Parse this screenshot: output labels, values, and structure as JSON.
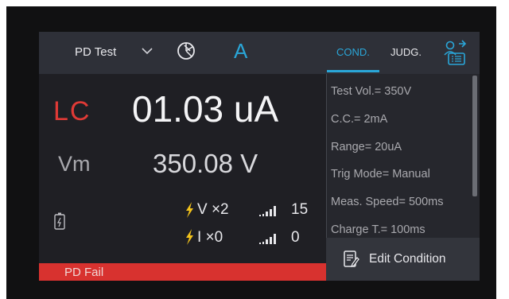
{
  "header": {
    "mode_label": "PD Test",
    "ameter_symbol": "A",
    "tabs": [
      {
        "label": "COND.",
        "active": true
      },
      {
        "label": "JUDG.",
        "active": false
      }
    ],
    "icons": [
      "chevron-down-icon",
      "pie-chart-icon",
      "user-list-icon"
    ]
  },
  "measurement": {
    "lc_label": "LC",
    "lc_value": "01.03 uA",
    "vm_label": "Vm",
    "vm_value": "350.08 V"
  },
  "counters": {
    "voltage": "V ×2",
    "current": "I ×0",
    "signal_1": "15",
    "signal_2": "0",
    "icons": [
      "battery-icon",
      "lightning-icon",
      "signal-bars-icon"
    ]
  },
  "status": {
    "text": "PD Fail"
  },
  "conditions": {
    "items": [
      "Test Vol.= 350V",
      "C.C.= 2mA",
      "Range= 20uA",
      "Trig Mode= Manual",
      "Meas. Speed= 500ms",
      "Charge T.= 100ms"
    ],
    "edit_button_label": "Edit Condition"
  },
  "colors": {
    "accent": "#2aa6d8",
    "alert": "#e03a36",
    "status_fail": "#d8322f",
    "lightning": "#f2c21b"
  }
}
